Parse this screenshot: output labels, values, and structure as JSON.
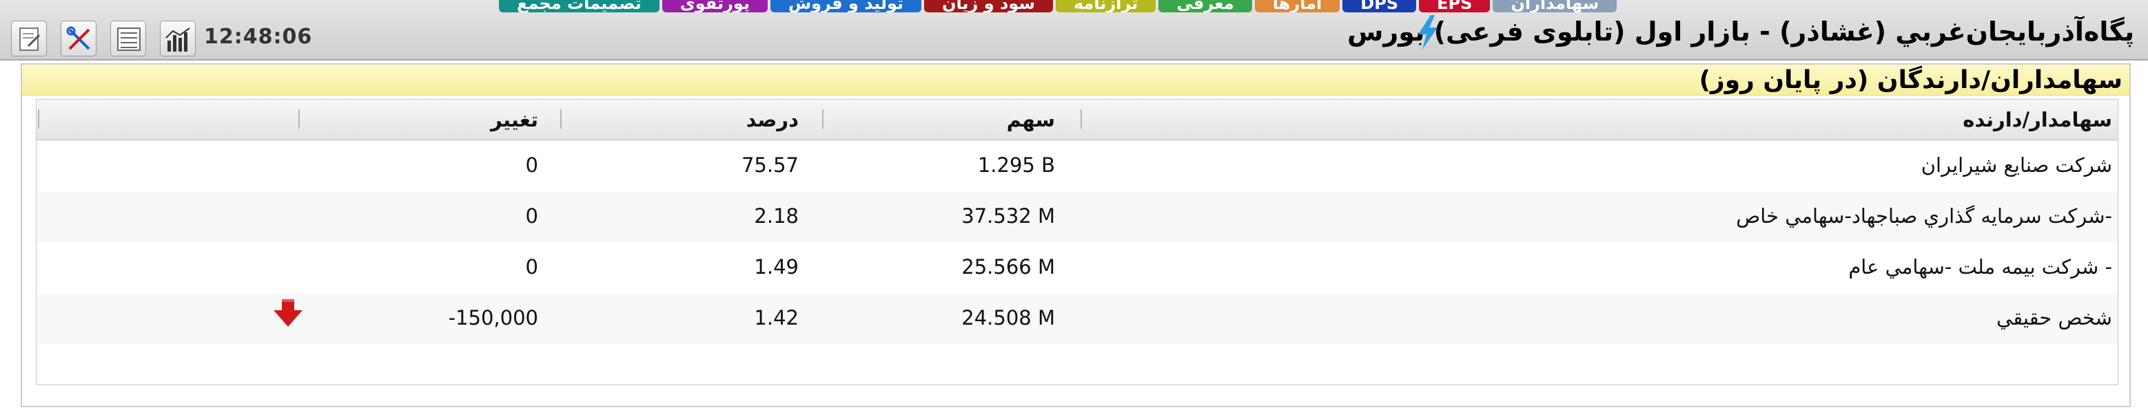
{
  "header": {
    "title": "پگاه‌آذربایجان‌غربي (غشاذر) - بازار اول (تابلوی فرعی) بورس",
    "clock": "12:48:06"
  },
  "tabs": [
    {
      "label": "سهامداران",
      "color": "#8aa0b8"
    },
    {
      "label": "EPS",
      "color": "#c8102e"
    },
    {
      "label": "DPS",
      "color": "#1a3fb0"
    },
    {
      "label": "آمارها",
      "color": "#e08a3c"
    },
    {
      "label": "معرفی",
      "color": "#3aa84a"
    },
    {
      "label": "ترازنامه",
      "color": "#b5b820"
    },
    {
      "label": "سود و زیان",
      "color": "#a01818"
    },
    {
      "label": "تولید و فروش",
      "color": "#1f6fd0"
    },
    {
      "label": "پورتفوی",
      "color": "#9b1fa8"
    },
    {
      "label": "تصمیمات مجمع",
      "color": "#14908a"
    }
  ],
  "panel": {
    "title": "سهامداران/دارندگان (در پایان روز)"
  },
  "table": {
    "columns": {
      "holder": "سهامدار/دارنده",
      "shares": "سهم",
      "percent": "درصد",
      "change": "تغییر"
    },
    "rows": [
      {
        "holder": "شركت صنايع شيرايران",
        "shares": "1.295 B",
        "percent": "75.57",
        "change": "0",
        "arrow": ""
      },
      {
        "holder": "شركت سرمايه گذاري صباجهاد-سهامي خاص-",
        "shares": "37.532 M",
        "percent": "2.18",
        "change": "0",
        "arrow": ""
      },
      {
        "holder": "شركت بيمه ملت -سهامي عام -",
        "shares": "25.566 M",
        "percent": "1.49",
        "change": "0",
        "arrow": ""
      },
      {
        "holder": "شخص حقيقي",
        "shares": "24.508 M",
        "percent": "1.42",
        "change": "-150,000",
        "arrow": "down-arrow-icon"
      }
    ]
  },
  "colors": {
    "panel_header_bg": "#f6ef9e",
    "down_arrow": "#d01818",
    "bolt": "#2e9be6"
  }
}
